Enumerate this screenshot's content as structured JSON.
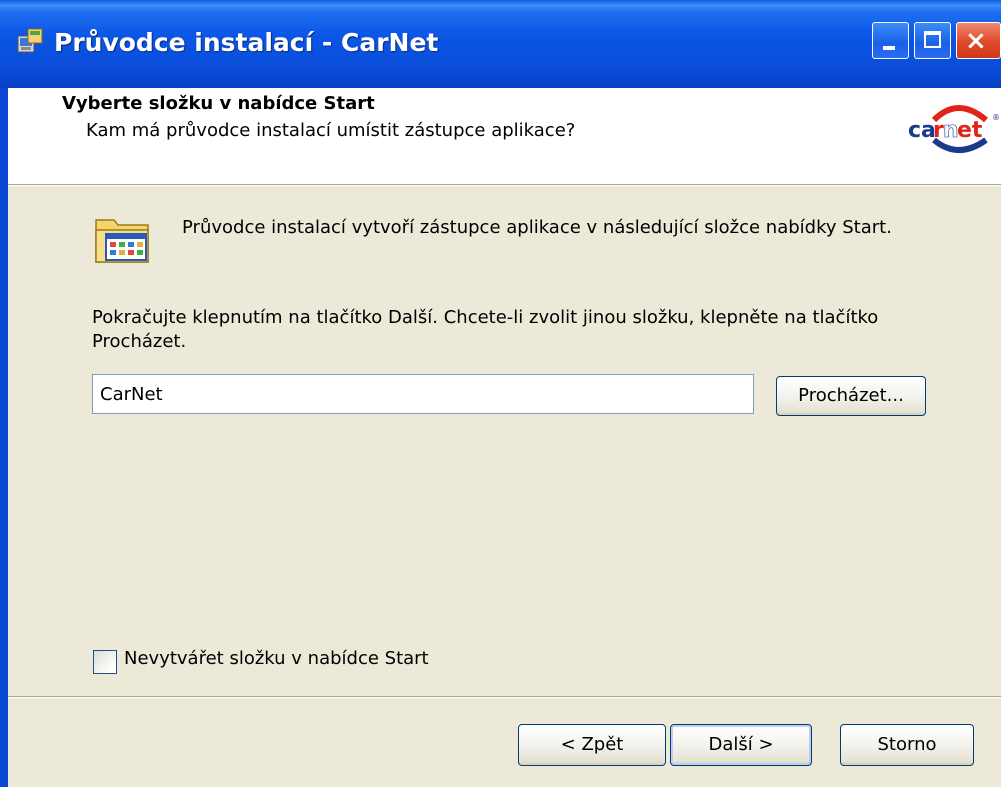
{
  "window": {
    "title": "Průvodce instalací - CarNet",
    "controls": {
      "minimize": "minimize",
      "maximize": "maximize",
      "close": "×"
    }
  },
  "header": {
    "title": "Vyberte složku v nabídce Start",
    "subtitle": "Kam má průvodce instalací umístit zástupce aplikace?",
    "logo_text": "carnet"
  },
  "main": {
    "info_text": "Průvodce instalací vytvoří zástupce aplikace v následující složce nabídky Start.",
    "instruction_text": "Pokračujte klepnutím na tlačítko Další. Chcete-li zvolit jinou složku, klepněte na tlačítko Procházet.",
    "folder_input": {
      "value": "CarNet"
    },
    "browse_button": "Procházet...",
    "no_folder_checkbox": {
      "label": "Nevytvářet složku v nabídce Start",
      "checked": false
    }
  },
  "footer": {
    "back_label": "< Zpět",
    "next_label": "Další >",
    "cancel_label": "Storno"
  },
  "colors": {
    "titlebar": "#0a4fdc",
    "dialog_bg": "#ece9d8",
    "header_bg": "#ffffff",
    "close_button": "#e0482a",
    "logo_red": "#e2231a",
    "logo_blue": "#1a3a8c"
  },
  "icons": {
    "app_icon": "installer-icon",
    "folder_icon": "program-folder-icon"
  }
}
